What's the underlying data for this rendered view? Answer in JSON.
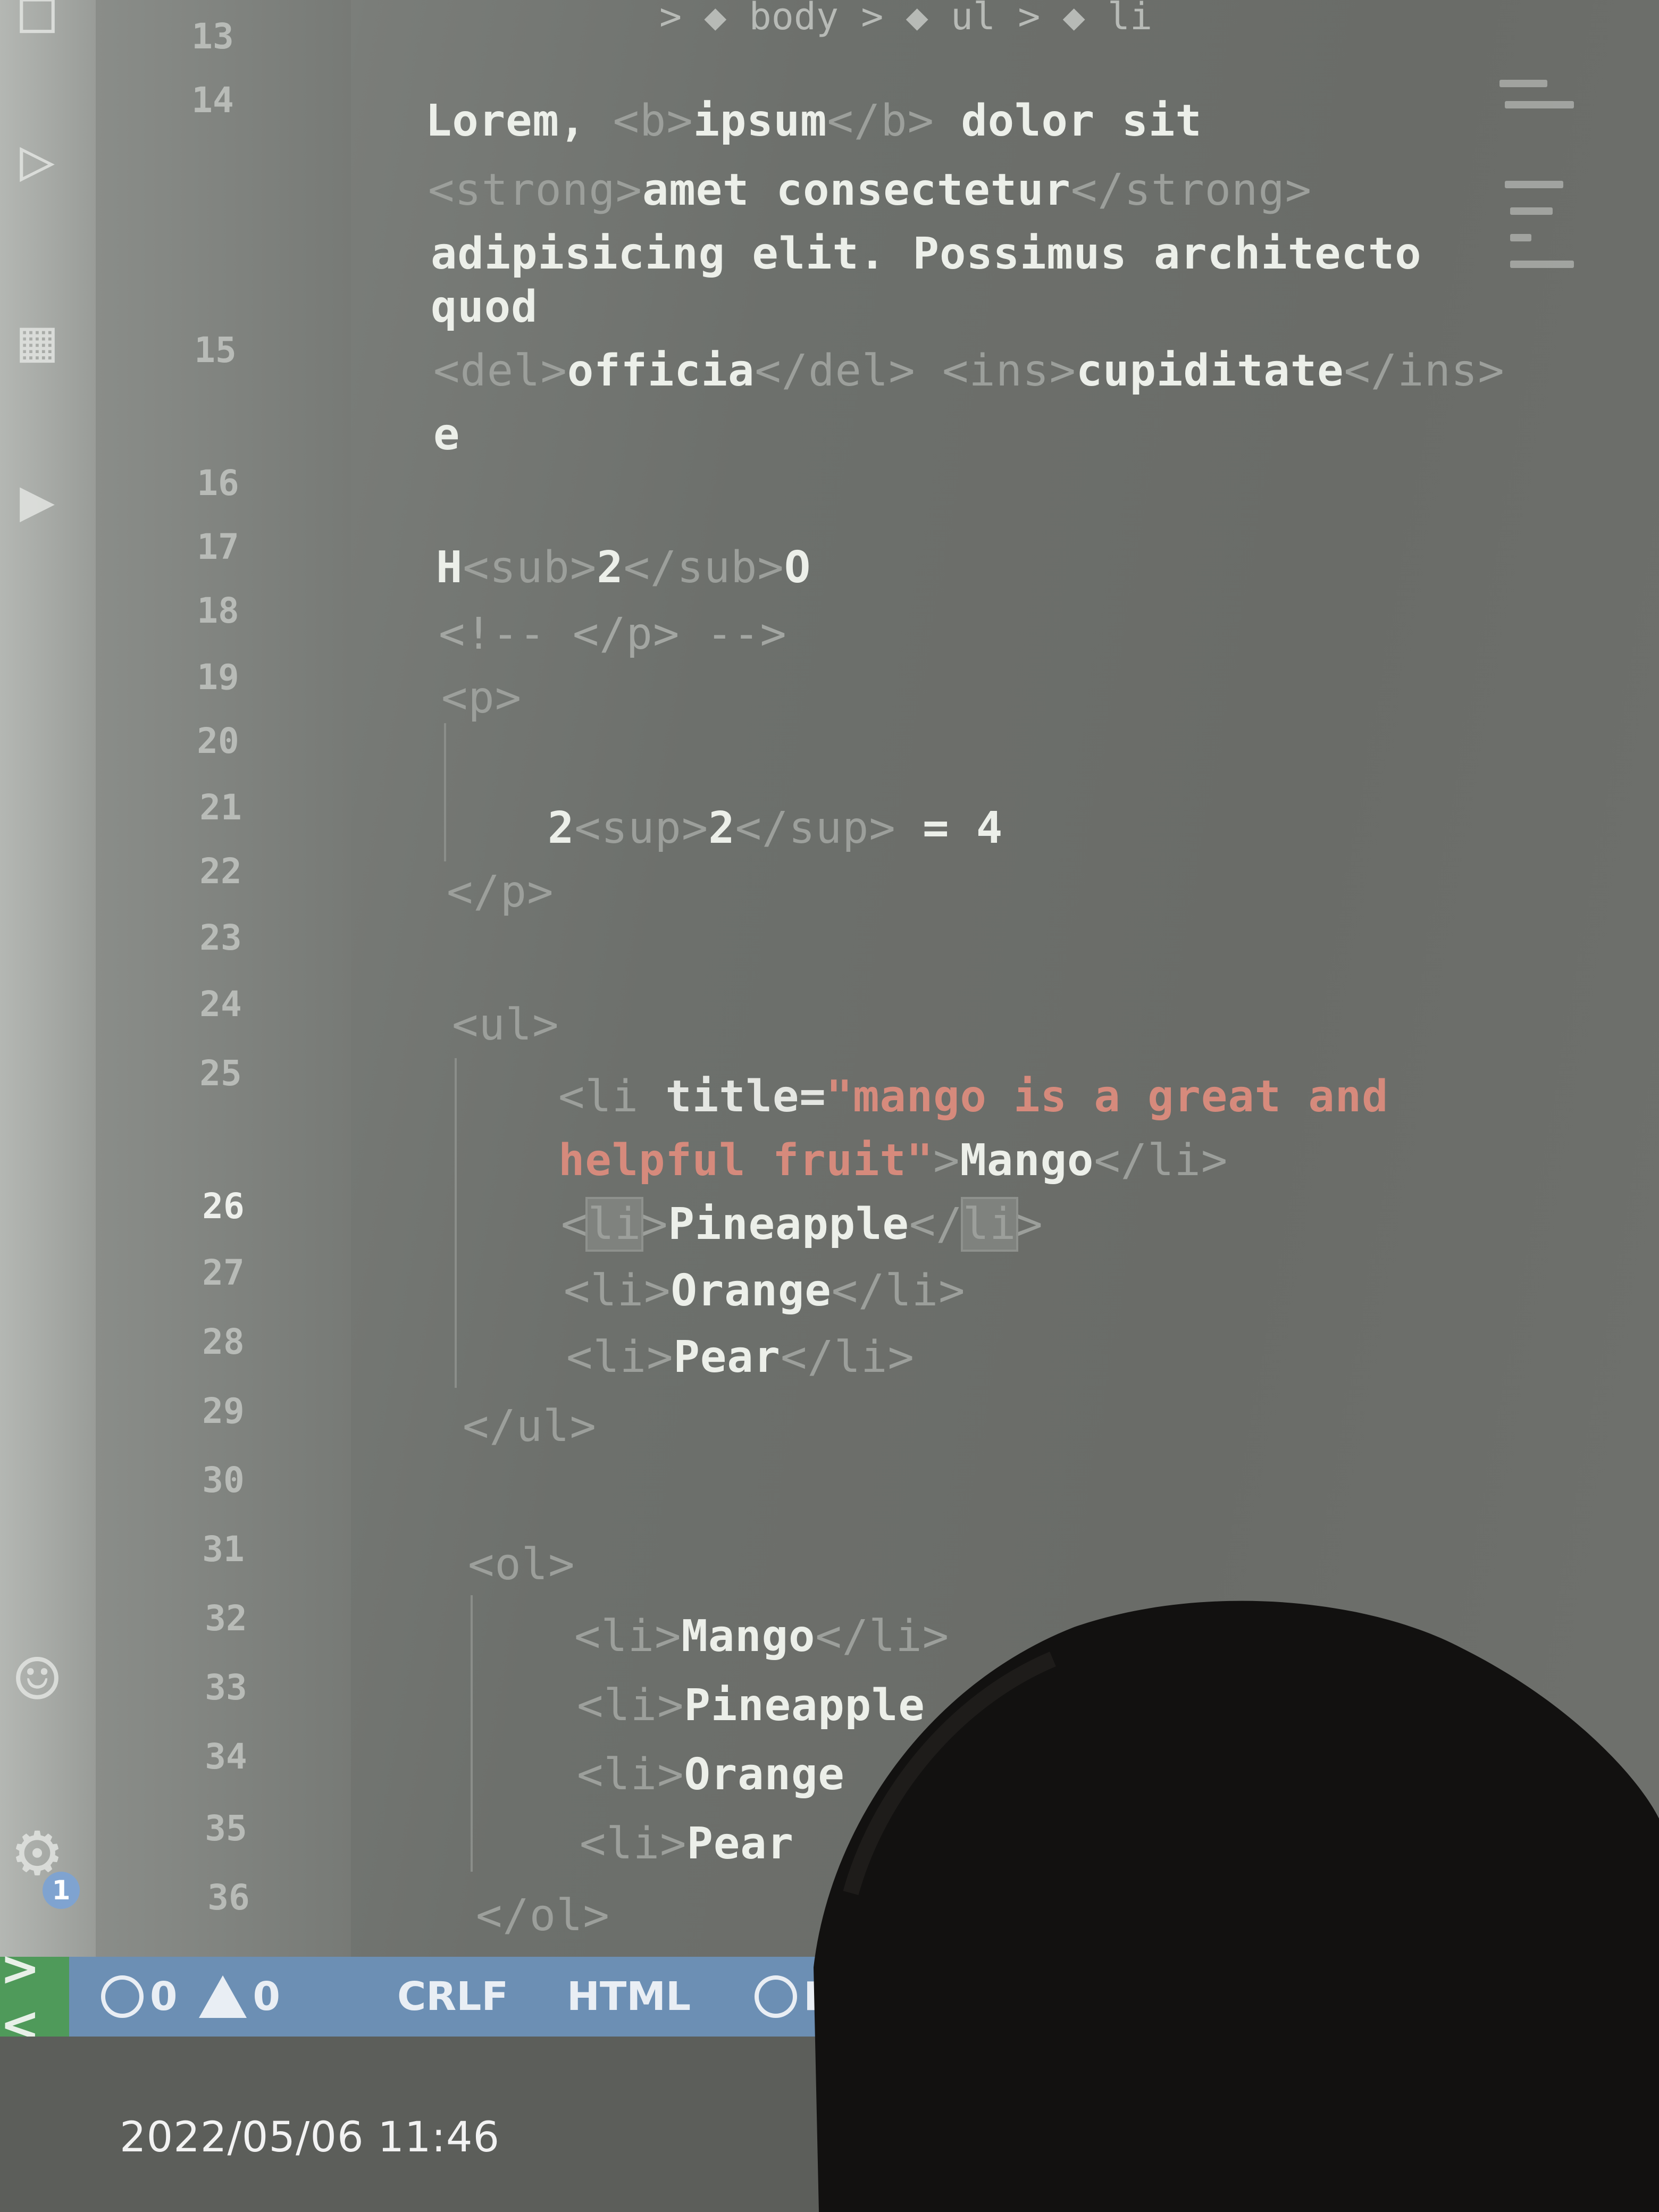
{
  "breadcrumb": "> ◆ body > ◆ ul > ◆ li",
  "timestamp": "2022/05/06 11:46",
  "line_numbers": [
    "13",
    "14",
    "15",
    "16",
    "17",
    "18",
    "19",
    "20",
    "21",
    "22",
    "23",
    "24",
    "25",
    "26",
    "27",
    "28",
    "29",
    "30",
    "31",
    "32",
    "33",
    "34",
    "35",
    "36"
  ],
  "active_line": "26",
  "code": {
    "l14a": {
      "t1": "Lorem, ",
      "t2": "<b>",
      "t3": "ipsum",
      "t4": "</b>",
      "t5": " dolor sit"
    },
    "l14b": {
      "t1": "<strong>",
      "t2": "amet consectetur",
      "t3": "</strong>"
    },
    "l14c": "adipisicing elit. Possimus architecto",
    "l14d": "quod",
    "l15a": {
      "t1": "<del>",
      "t2": "officia",
      "t3": "</del>",
      "t4": " <ins>",
      "t5": "cupiditate",
      "t6": "</ins>"
    },
    "l15b": "e",
    "l17": {
      "t1": "H",
      "t2": "<sub>",
      "t3": "2",
      "t4": "</sub>",
      "t5": "O"
    },
    "l18": "<!-- </p> -->",
    "l19": "<p>",
    "l21": {
      "t1": "2",
      "t2": "<sup>",
      "t3": "2",
      "t4": "</sup>",
      "t5": " = 4"
    },
    "l22": "</p>",
    "l24": "<ul>",
    "l25a": {
      "t1": "<li ",
      "t2": "title=",
      "t3": "\"mango is a great and"
    },
    "l25b": {
      "t1": "helpful fruit\"",
      "t2": ">",
      "t3": "Mango",
      "t4": "</li>"
    },
    "l26": {
      "t1": "<",
      "t2": "li",
      "t3": ">",
      "t4": "Pineapple",
      "t5": "</",
      "t6": "li",
      "t7": ">"
    },
    "l27": {
      "t1": "<li>",
      "t2": "Orange",
      "t3": "</li>"
    },
    "l28": {
      "t1": "<li>",
      "t2": "Pear",
      "t3": "</li>"
    },
    "l29": "</ul>",
    "l31": "<ol>",
    "l32": {
      "t1": "<li>",
      "t2": "Mango",
      "t3": "</li>"
    },
    "l33": {
      "t1": "<li>",
      "t2": "Pineapple"
    },
    "l34": {
      "t1": "<li>",
      "t2": "Orange"
    },
    "l35": {
      "t1": "<li>",
      "t2": "Pear"
    },
    "l36": "</ol>"
  },
  "status_bar": {
    "remote_icon": "><",
    "errors": "0",
    "warnings": "0",
    "line_ending": "CRLF",
    "language": "HTML",
    "prettier": "P"
  },
  "activity_icons": [
    "files-icon",
    "run-debug-icon",
    "extensions-icon",
    "remote-explorer-icon",
    "accounts-icon",
    "settings-gear-icon"
  ],
  "settings_badge": "1",
  "colors": {
    "status_bar": "#6c8fb4",
    "remote": "#4f9a5a",
    "string": "#d68a7c"
  }
}
